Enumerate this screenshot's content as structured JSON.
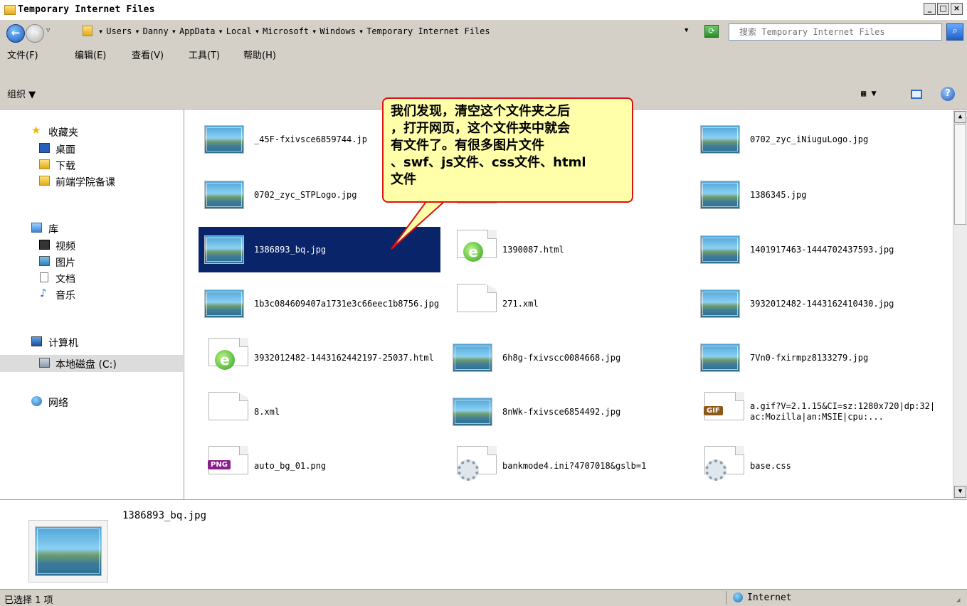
{
  "window": {
    "title": "Temporary Internet Files"
  },
  "address": {
    "crumbs": [
      "Users",
      "Danny",
      "AppData",
      "Local",
      "Microsoft",
      "Windows",
      "Temporary Internet Files"
    ],
    "separator": "▸"
  },
  "search": {
    "placeholder": "搜索 Temporary Internet Files"
  },
  "menu": [
    "文件(F)",
    "编辑(E)",
    "查看(V)",
    "工具(T)",
    "帮助(H)"
  ],
  "toolbar": {
    "organize": "组织 ▼"
  },
  "nav": {
    "favorites": "收藏夹",
    "desktop": "桌面",
    "downloads": "下载",
    "frontend": "前端学院备课",
    "library": "库",
    "videos": "视频",
    "pictures": "图片",
    "documents": "文档",
    "music": "音乐",
    "computer": "计算机",
    "local_disk": "本地磁盘 (C:)",
    "network": "网络"
  },
  "files": [
    {
      "name": "_45F-fxivsce6859744.jp",
      "type": "image"
    },
    {
      "name": "",
      "type": "hidden"
    },
    {
      "name": "0702_zyc_iNiuguLogo.jpg",
      "type": "image"
    },
    {
      "name": "0702_zyc_STPLogo.jpg",
      "type": "image"
    },
    {
      "name": "",
      "type": "png"
    },
    {
      "name": "1386345.jpg",
      "type": "image"
    },
    {
      "name": "1386893_bq.jpg",
      "type": "image",
      "selected": true
    },
    {
      "name": "1390087.html",
      "type": "html"
    },
    {
      "name": "1401917463-1444702437593.jpg",
      "type": "image"
    },
    {
      "name": "1b3c084609407a1731e3c66eec1b8756.jpg",
      "type": "image"
    },
    {
      "name": "271.xml",
      "type": "file"
    },
    {
      "name": "3932012482-1443162410430.jpg",
      "type": "image"
    },
    {
      "name": "3932012482-1443162442197-25037.html",
      "type": "html"
    },
    {
      "name": "6h8g-fxivscc0084668.jpg",
      "type": "image"
    },
    {
      "name": "7Vn0-fxirmpz8133279.jpg",
      "type": "image"
    },
    {
      "name": "8.xml",
      "type": "file"
    },
    {
      "name": "8nWk-fxivsce6854492.jpg",
      "type": "image"
    },
    {
      "name": "a.gif?V=2.1.15&CI=sz:1280x720|dp:32|ac:Mozilla|an:MSIE|cpu:...",
      "type": "gif"
    },
    {
      "name": "auto_bg_01.png",
      "type": "png"
    },
    {
      "name": "bankmode4.ini?4707018&gslb=1",
      "type": "config"
    },
    {
      "name": "base.css",
      "type": "config"
    }
  ],
  "callout": {
    "text": "我们发现，清空这个文件夹之后\n，打开网页，这个文件夹中就会\n有文件了。有很多图片文件\n、swf、js文件、css文件、html\n文件"
  },
  "details": {
    "name": "1386893_bq.jpg"
  },
  "status": {
    "left": "已选择 1 项",
    "zone": "Internet"
  },
  "badges": {
    "png": "PNG",
    "gif": "GIF"
  }
}
